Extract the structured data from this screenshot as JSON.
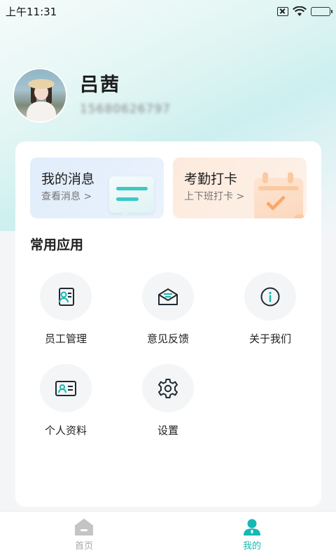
{
  "status_bar": {
    "time": "上午11:31",
    "battery_percent": 100
  },
  "profile": {
    "name": "吕茜",
    "phone": "15680626797"
  },
  "quick_cards": [
    {
      "title": "我的消息",
      "subtitle": "查看消息 >",
      "icon": "message-illustration"
    },
    {
      "title": "考勤打卡",
      "subtitle": "上下班打卡 >",
      "icon": "calendar-check-illustration"
    }
  ],
  "section_title": "常用应用",
  "apps": [
    {
      "label": "员工管理",
      "icon": "employee-badge-icon"
    },
    {
      "label": "意见反馈",
      "icon": "envelope-icon"
    },
    {
      "label": "关于我们",
      "icon": "info-icon"
    },
    {
      "label": "个人资料",
      "icon": "id-card-icon"
    },
    {
      "label": "设置",
      "icon": "gear-icon"
    }
  ],
  "tabbar": {
    "items": [
      {
        "label": "首页",
        "icon": "home-icon",
        "active": false
      },
      {
        "label": "我的",
        "icon": "user-icon",
        "active": true
      }
    ]
  },
  "colors": {
    "accent": "#15b9b4",
    "inactive": "#aaaaaa"
  }
}
